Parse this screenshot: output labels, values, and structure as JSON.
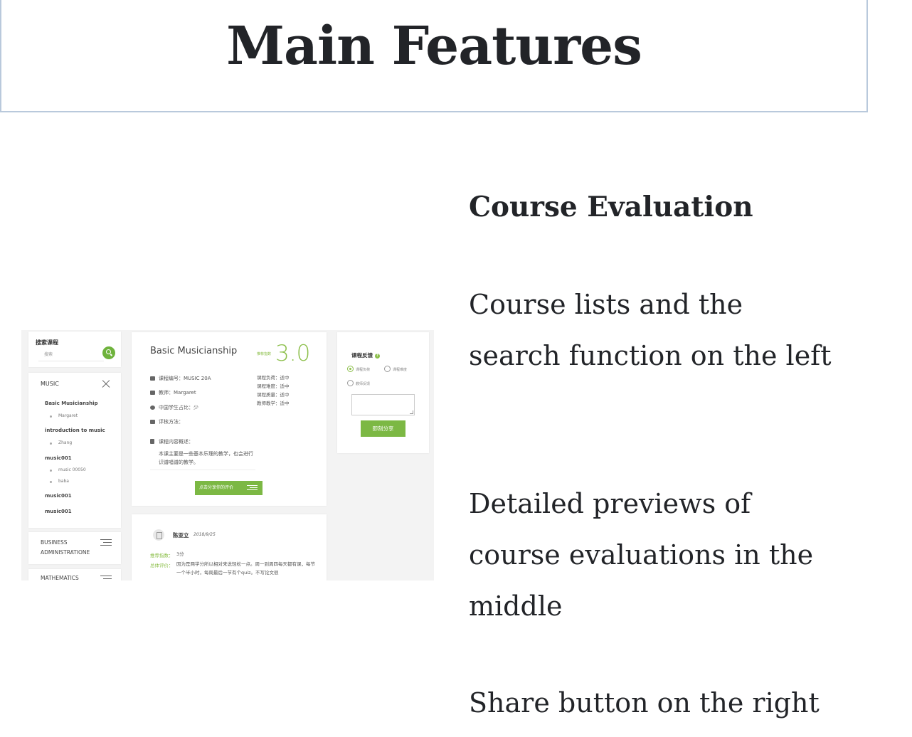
{
  "header": {
    "title": "Main Features"
  },
  "section": {
    "title": "Course Evaluation",
    "paragraphs": [
      "Course lists and the search function on the left",
      "Detailed previews of course evaluations in the middle",
      "Share button on the right"
    ]
  },
  "screenshot": {
    "search": {
      "title": "搜索课程",
      "placeholder": "搜索"
    },
    "category": "MUSIC",
    "tree": [
      {
        "label": "Basic Musicianship",
        "sub": [
          "Margaret"
        ]
      },
      {
        "label": "introduction to music",
        "sub": [
          "Zhang"
        ]
      },
      {
        "label": "music001",
        "sub": [
          "music 00050",
          "baba"
        ]
      },
      {
        "label": "music001",
        "sub": []
      },
      {
        "label": "music001",
        "sub": []
      }
    ],
    "other_categories": [
      "BUSINESS ADMINISTRATIONE",
      "MATHEMATICS"
    ],
    "course": {
      "title": "Basic Musicianship",
      "score_label": "推荐指数",
      "score": "3.0",
      "info": [
        "课程编号：MUSIC 20A",
        "教师：Margaret",
        "中国学生占比：少",
        "评核方法："
      ],
      "ratings": [
        "课程负荷：适中",
        "课程难度：适中",
        "课程质量：适中",
        "教师教学：适中"
      ],
      "desc_label": "课程内容概述：",
      "desc_text": "本课主要是一些基本乐理的教学，也会进行识谱唱谱的教学。",
      "share_eval_button": "点击分享你的评价"
    },
    "review": {
      "name": "陈亚立",
      "date": "2018/9/25",
      "score_label": "推荐指数：",
      "score_value": "3分",
      "overall_label": "总体评价：",
      "overall_text": "因为是两学分所以相对来说轻松一点。周一到周四每天都有课，每节一个半小时，每周最后一节有个quiz。不写论文很"
    },
    "feedback": {
      "title": "课程反馈",
      "options": [
        "课程负荷",
        "课程难度",
        "教师反馈"
      ],
      "share_button": "即刻分享"
    }
  }
}
